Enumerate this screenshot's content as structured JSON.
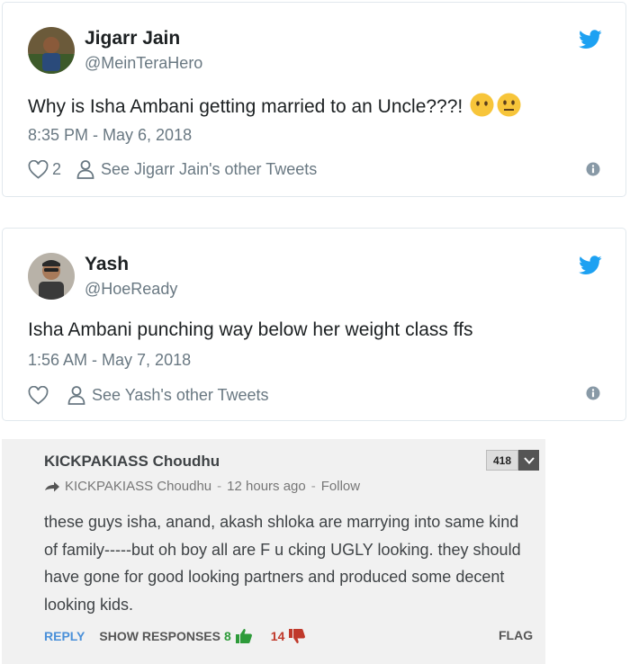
{
  "tweets": [
    {
      "name": "Jigarr Jain",
      "handle": "@MeinTeraHero",
      "text": "Why is Isha Ambani getting married to an Uncle???!",
      "emojis": [
        "no-mouth-face-icon",
        "neutral-face-icon"
      ],
      "time": "8:35 PM - May 6, 2018",
      "likes": "2",
      "other_tweets": "See Jigarr Jain's other Tweets"
    },
    {
      "name": "Yash",
      "handle": "@HoeReady",
      "text": "Isha Ambani punching way below her weight class ffs",
      "time": "1:56 AM - May 7, 2018",
      "likes": "",
      "other_tweets": "See Yash's other Tweets"
    }
  ],
  "comment": {
    "author": "KICKPAKIASS Choudhu",
    "score": "418",
    "meta_author": "KICKPAKIASS Choudhu",
    "time_ago": "12 hours ago",
    "follow": "Follow",
    "body": "these guys isha, anand, akash shloka are marrying into same kind of family-----but oh boy all are F u cking UGLY looking. they should have gone for good looking partners and produced some decent looking kids.",
    "reply": "REPLY",
    "show_responses": "SHOW RESPONSES",
    "upvotes": "8",
    "downvotes": "14",
    "flag": "FLAG"
  },
  "colors": {
    "twitter_blue": "#1da1f2",
    "reply_blue": "#4a90d9",
    "upvote_green": "#2e9b3a",
    "downvote_red": "#c0392b"
  }
}
